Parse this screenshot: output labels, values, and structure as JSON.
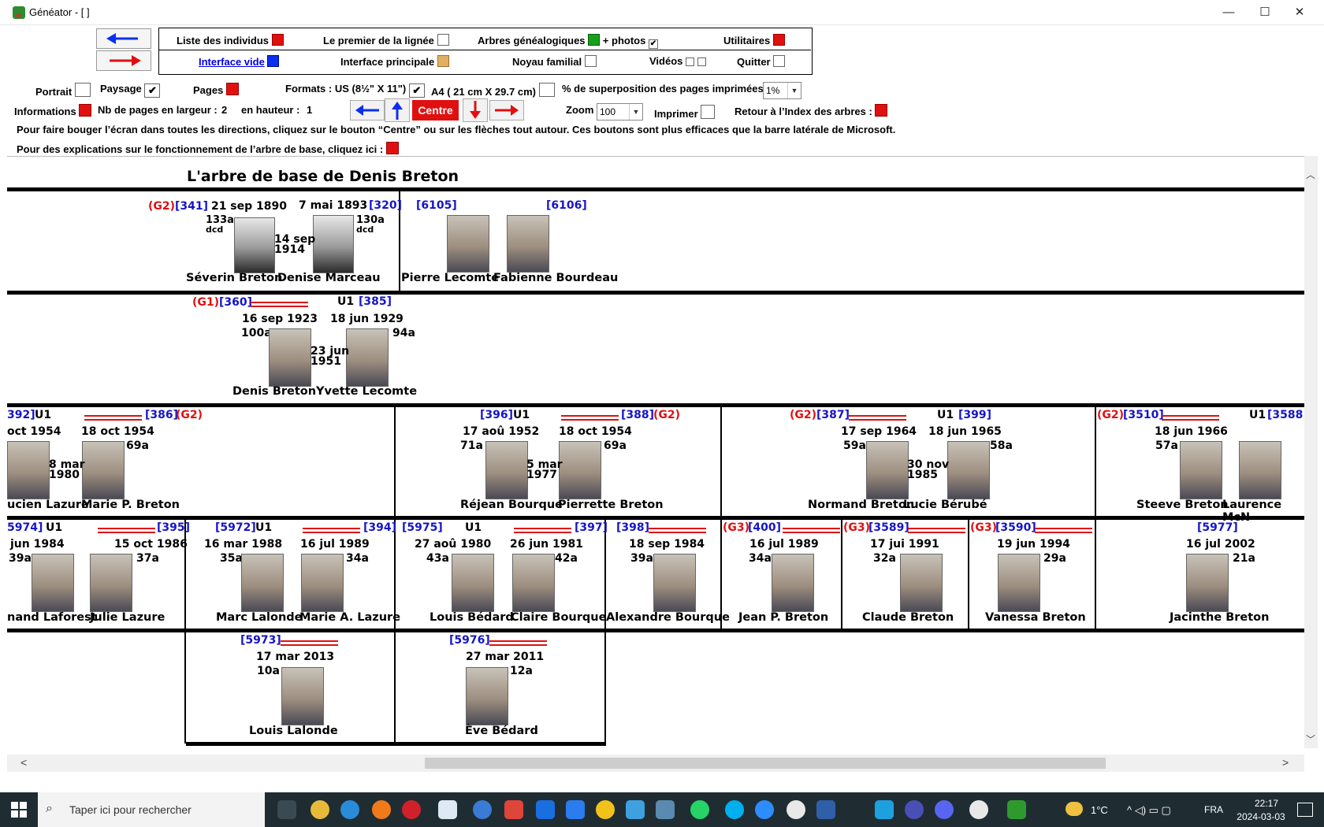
{
  "window": {
    "title": "Généator - [ ]",
    "btn_min": "—",
    "btn_max": "☐",
    "btn_close": "✕"
  },
  "menu": {
    "liste_individus": "Liste des individus",
    "premier_lignee": "Le premier de la lignée",
    "arbres": "Arbres généalogiques",
    "plus_photos": "+ photos",
    "utilitaires": "Utilitaires",
    "interface_vide": "Interface vide",
    "interface_principale": "Interface principale",
    "noyau_familial": "Noyau familial",
    "videos": "Vidéos",
    "quitter": "Quitter"
  },
  "options": {
    "portrait": "Portrait",
    "paysage": "Paysage",
    "pages": "Pages",
    "formats": "Formats : US (8½\" X 11\")",
    "a4": "A4 ( 21 cm X 29.7 cm)",
    "superposition": "% de superposition des pages imprimées",
    "superposition_value": "1%",
    "informations": "Informations",
    "nb_largeur": "Nb de pages en largeur :",
    "nb_largeur_value": "2",
    "hauteur": "en hauteur :",
    "hauteur_value": "1",
    "centre": "Centre",
    "zoom": "Zoom",
    "zoom_value": "100",
    "imprimer": "Imprimer",
    "retour": "Retour à l’Index des arbres :",
    "check": "✔",
    "info_line1": "Pour faire bouger l’écran dans toutes les directions, cliquez sur le bouton “Centre” ou sur les flèches tout autour. Ces boutons sont plus efficaces que la barre latérale de Microsoft.",
    "info_line2": "Pour des explications sur le fonctionnement de l’arbre de base, cliquez ici :"
  },
  "tree": {
    "title": "L'arbre de base de Denis Breton",
    "row1": {
      "left_gen": "(G2)",
      "left_ref": "[341]",
      "left_date": "21 sep 1890",
      "left_age": "133a",
      "left_dcd": "dcd",
      "right_date": "7 mai 1893",
      "right_ref": "[320]",
      "right_age": "130a",
      "right_dcd": "dcd",
      "marriage_a": "14 sep",
      "marriage_b": "1914",
      "name_a": "Séverin Breton",
      "name_b": "Denise Marceau",
      "p2_ref_a": "[6105]",
      "p2_ref_b": "[6106]",
      "p2_name_a": "Pierre Lecomte",
      "p2_name_b": "Fabienne Bourdeau"
    },
    "row2": {
      "gen": "(G1)",
      "ref_a": "[360]",
      "u": "U1",
      "ref_b": "[385]",
      "date_a": "16 sep 1923",
      "age_a": "100a",
      "date_b": "18 jun 1929",
      "age_b": "94a",
      "marriage_a": "23 jun",
      "marriage_b": "1951",
      "name_a": "Denis Breton",
      "name_b": "Yvette Lecomte"
    },
    "row3": [
      {
        "ref_a": "392]",
        "u": "U1",
        "ref_b": "[386]",
        "gen_b": "(G2)",
        "date_a": "oct 1954",
        "date_b": "18 oct 1954",
        "age_b": "69a",
        "m_a": "8 mar",
        "m_b": "1980",
        "name_a": "ucien Lazure",
        "name_b": "Marie P. Breton"
      },
      {
        "ref_a": "[396]",
        "u": "U1",
        "ref_b": "[388]",
        "gen_b": "(G2)",
        "date_a": "17 aoû 1952",
        "age_a": "71a",
        "date_b": "18 oct 1954",
        "age_b": "69a",
        "m_a": "5 mar",
        "m_b": "1977",
        "name_a": "Réjean Bourque",
        "name_b": "Pierrette Breton"
      },
      {
        "gen_a": "(G2)",
        "ref_a": "[387]",
        "u": "U1",
        "ref_b": "[399]",
        "date_a": "17 sep 1964",
        "age_a": "59a",
        "date_b": "18 jun 1965",
        "age_b": "58a",
        "m_a": "30 nov",
        "m_b": "1985",
        "name_a": "Normand Breton",
        "name_b": "Lucie Bérubé"
      },
      {
        "gen_a": "(G2)",
        "ref_a": "[3510]",
        "u": "U1",
        "ref_b": "[3588",
        "date_a": "18 jun 1966",
        "age_a": "57a",
        "name_a": "Steeve Breton",
        "name_b": "Laurence McN"
      }
    ],
    "row4": [
      {
        "ref_a": "5974]",
        "u": "U1",
        "ref_b": "[395]",
        "date_a": "jun 1984",
        "age_a": "39a",
        "date_b": "15 oct 1986",
        "age_b": "37a",
        "name_a": "nand Laforest",
        "name_b": "Julie Lazure"
      },
      {
        "ref_a": "[5972]",
        "u": "U1",
        "ref_b": "[394]",
        "date_a": "16 mar 1988",
        "age_a": "35a",
        "date_b": "16 jul 1989",
        "age_b": "34a",
        "name_a": "Marc Lalonde",
        "name_b": "Marie A. Lazure"
      },
      {
        "ref_a": "[5975]",
        "u": "U1",
        "ref_b": "[397]",
        "date_a": "27 aoû 1980",
        "age_a": "43a",
        "date_b": "26 jun 1981",
        "age_b": "42a",
        "name_a": "Louis Bédard",
        "name_b": "Claire Bourque"
      },
      {
        "ref": "[398]",
        "date": "18 sep 1984",
        "age": "39a",
        "name": "Alexandre Bourque"
      },
      {
        "gen": "(G3)",
        "ref": "[400]",
        "date": "16 jul 1989",
        "age": "34a",
        "name": "Jean P. Breton"
      },
      {
        "gen": "(G3)",
        "ref": "[3589]",
        "date": "17 jui 1991",
        "age": "32a",
        "name": "Claude Breton"
      },
      {
        "gen": "(G3)",
        "ref": "[3590]",
        "date": "19 jun 1994",
        "age": "29a",
        "name": "Vanessa Breton"
      },
      {
        "ref": "[5977]",
        "date": "16 jul 2002",
        "age": "21a",
        "name": "Jacinthe Breton"
      }
    ],
    "row5": [
      {
        "ref": "[5973]",
        "date": "17 mar 2013",
        "age": "10a",
        "name": "Louis Lalonde"
      },
      {
        "ref": "[5976]",
        "date": "27 mar 2011",
        "age": "12a",
        "name": "Ève Bédard"
      }
    ]
  },
  "taskbar": {
    "search_placeholder": "Taper ici pour rechercher",
    "weather": "1°C",
    "lang": "FRA",
    "time": "22:17",
    "date": "2024-03-03"
  },
  "colors": {
    "accent_red": "#e01010",
    "accent_blue": "#0a2ff0",
    "ref_blue": "#1515c8",
    "taskbar": "#1f2d33"
  }
}
